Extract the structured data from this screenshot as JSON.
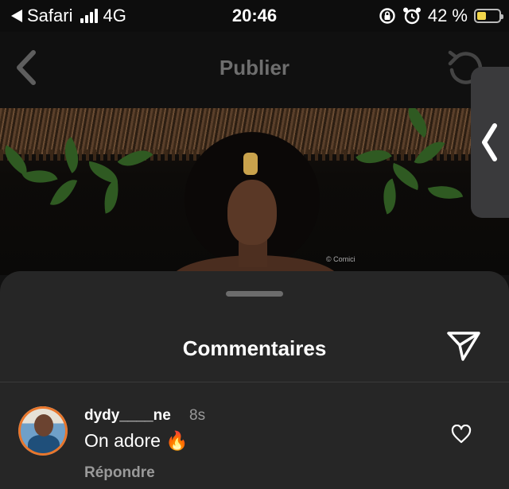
{
  "status_bar": {
    "back_app": "Safari",
    "network": "4G",
    "time": "20:46",
    "battery": "42 %",
    "battery_level": 0.42,
    "icons": [
      "back-arrow-icon",
      "signal-icon",
      "rotation-lock-icon",
      "alarm-icon",
      "battery-icon"
    ]
  },
  "nav": {
    "title": "Publier",
    "icons": [
      "chevron-left-icon",
      "reset-icon"
    ]
  },
  "photo": {
    "watermark": "© Comici"
  },
  "side_tab": {
    "icon": "chevron-left-icon"
  },
  "comments": {
    "title": "Commentaires",
    "send_icon": "send-icon",
    "items": [
      {
        "username": "dydy____ne",
        "time": "8s",
        "text": "On adore 🔥",
        "reply_label": "Répondre",
        "like_icon": "heart-icon"
      }
    ]
  },
  "colors": {
    "background": "#111111",
    "sheet": "#262626",
    "muted_text": "#9a9a9a",
    "battery_fill": "#f2d64b"
  }
}
